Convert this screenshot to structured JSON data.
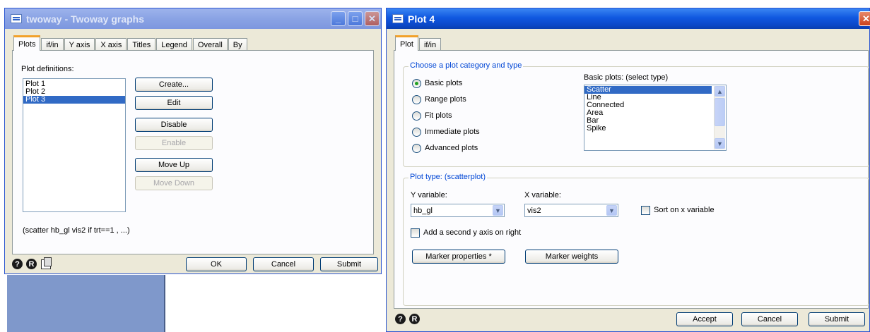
{
  "twoway": {
    "title": "twoway - Twoway graphs",
    "tabs": [
      "Plots",
      "if/in",
      "Y axis",
      "X axis",
      "Titles",
      "Legend",
      "Overall",
      "By"
    ],
    "plot_definitions_label": "Plot definitions:",
    "plots": [
      "Plot 1",
      "Plot 2",
      "Plot 3"
    ],
    "buttons": {
      "create": "Create...",
      "edit": "Edit",
      "disable": "Disable",
      "enable": "Enable",
      "move_up": "Move Up",
      "move_down": "Move Down"
    },
    "command_preview": "(scatter hb_gl vis2  if trt==1 , ...)",
    "footer": {
      "ok": "OK",
      "cancel": "Cancel",
      "submit": "Submit"
    },
    "icons": [
      "help-icon",
      "reset-icon",
      "copy-icon"
    ]
  },
  "plot4": {
    "title": "Plot 4",
    "tabs": [
      "Plot",
      "if/in"
    ],
    "category_group_title": "Choose a plot category and type",
    "categories": [
      "Basic plots",
      "Range plots",
      "Fit plots",
      "Immediate plots",
      "Advanced plots"
    ],
    "selected_category": "Basic plots",
    "basic_plots_label": "Basic plots: (select type)",
    "basic_plot_types": [
      "Scatter",
      "Line",
      "Connected",
      "Area",
      "Bar",
      "Spike"
    ],
    "selected_type": "Scatter",
    "plot_type_group_title": "Plot type: (scatterplot)",
    "y_variable_label": "Y variable:",
    "y_variable_value": "hb_gl",
    "x_variable_label": "X variable:",
    "x_variable_value": "vis2",
    "sort_label": "Sort on x variable",
    "second_y_axis_label": "Add a second y axis on right",
    "marker_properties_label": "Marker properties *",
    "marker_weights_label": "Marker weights",
    "footer": {
      "accept": "Accept",
      "cancel": "Cancel",
      "submit": "Submit"
    }
  },
  "colors": {
    "titlebar": "#0b48c9",
    "dialog_bg": "#ece9d8",
    "selection": "#316ac5",
    "group_title": "#0046d5",
    "tab_accent": "#f2a12a"
  }
}
